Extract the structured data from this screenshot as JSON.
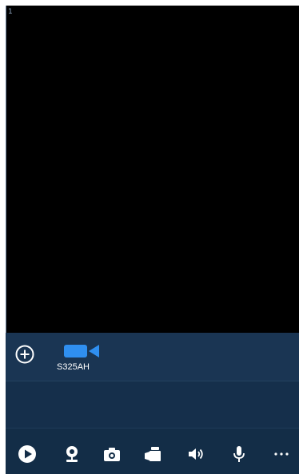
{
  "video": {
    "channel_index": "1"
  },
  "device_list": {
    "add_icon": "plus-circle-icon",
    "devices": [
      {
        "label": "S325AH",
        "icon": "video-camera-icon",
        "color": "#2f8ff0"
      }
    ]
  },
  "toolbar": {
    "icons": [
      "play-icon",
      "webcam-icon",
      "camera-icon",
      "record-icon",
      "volume-icon",
      "microphone-icon",
      "more-icon"
    ]
  },
  "colors": {
    "panel": "#132d47",
    "device_row": "#1a3553",
    "accent": "#2f8ff0",
    "icon": "#ffffff"
  }
}
